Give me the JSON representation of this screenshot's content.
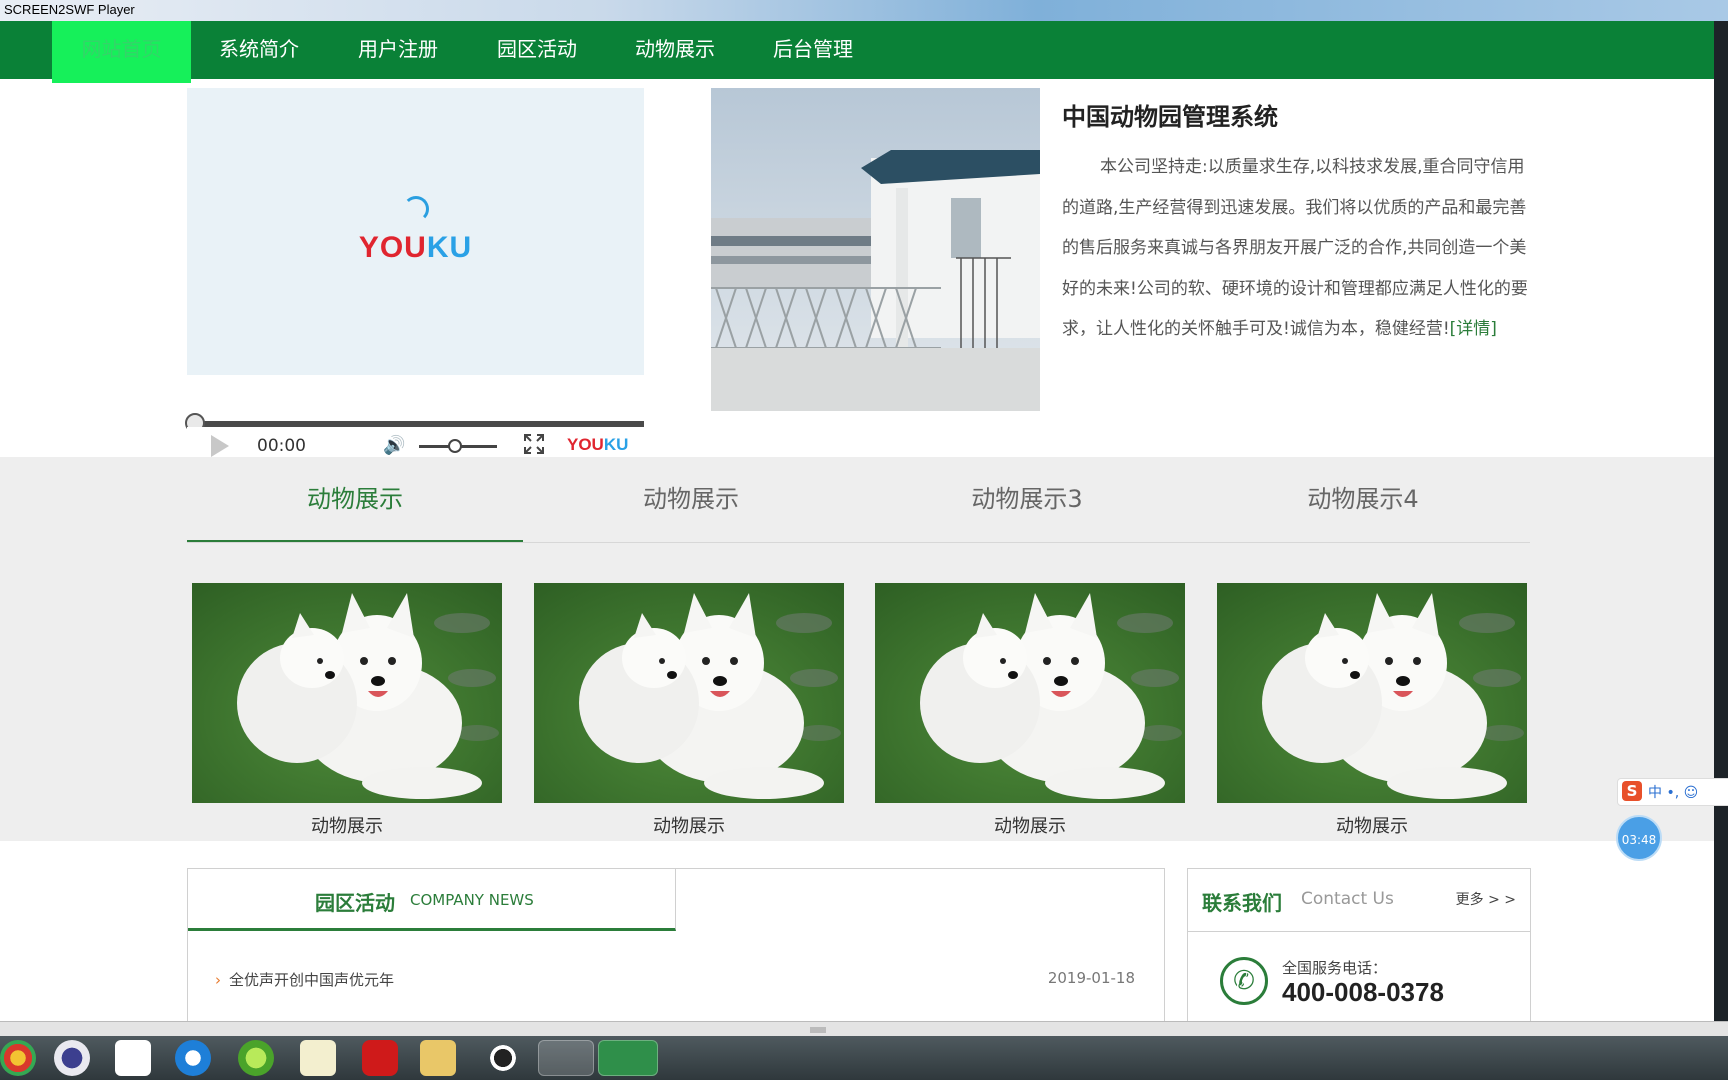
{
  "window": {
    "title": "SCREEN2SWF Player"
  },
  "nav": {
    "items": [
      {
        "label": "网站首页",
        "active": true
      },
      {
        "label": "系统简介",
        "active": false
      },
      {
        "label": "用户注册",
        "active": false
      },
      {
        "label": "园区活动",
        "active": false
      },
      {
        "label": "动物展示",
        "active": false
      },
      {
        "label": "后台管理",
        "active": false
      }
    ]
  },
  "video": {
    "brand_you": "YOU",
    "brand_ku": "KU",
    "time": "00:00",
    "progress": 0,
    "volume": 0.45,
    "small_brand_you": "YOU",
    "small_brand_ku": "KU"
  },
  "intro": {
    "title": "中国动物园管理系统",
    "body": "本公司坚持走:以质量求生存,以科技求发展,重合同守信用的道路,生产经营得到迅速发展。我们将以优质的产品和最完善的售后服务来真诚与各界朋友开展广泛的合作,共同创造一个美好的未来!公司的软、硬环境的设计和管理都应满足人性化的要求，让人性化的关怀触手可及!诚信为本，稳健经营!",
    "link": "[详情]"
  },
  "gallery": {
    "tabs": [
      {
        "label": "动物展示",
        "active": true
      },
      {
        "label": "动物展示",
        "active": false
      },
      {
        "label": "动物展示3",
        "active": false
      },
      {
        "label": "动物展示4",
        "active": false
      }
    ],
    "items": [
      {
        "caption": "动物展示"
      },
      {
        "caption": "动物展示"
      },
      {
        "caption": "动物展示"
      },
      {
        "caption": "动物展示"
      }
    ]
  },
  "news": {
    "title": "园区活动",
    "subtitle": "COMPANY NEWS",
    "items": [
      {
        "text": "全优声开创中国声优元年",
        "date": "2019-01-18"
      }
    ]
  },
  "contact": {
    "title": "联系我们",
    "subtitle": "Contact Us",
    "more": "更多 > >",
    "label": "全国服务电话：",
    "phone": "400-008-0378"
  },
  "widgets": {
    "ime_logo": "S",
    "ime_mode": "中 •, ☺",
    "timer": "03:48"
  },
  "colors": {
    "nav_green": "#0a8137",
    "accent_green": "#2b7d3a",
    "active_nav": "#16f05a"
  }
}
